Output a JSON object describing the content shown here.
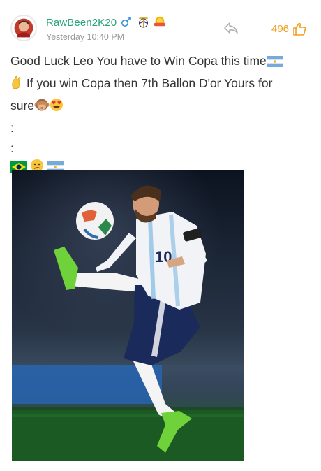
{
  "post": {
    "username": "RawBeen2K20",
    "timestamp": "Yesterday 10:40 PM",
    "likes": "496",
    "lines": [
      "Good Luck Leo You have to Win Copa this time",
      " If you win Copa then 7th Ballon D'or Yours for",
      "sure",
      ":",
      ":"
    ],
    "image_jersey_number": "10"
  },
  "icons": {
    "gender": "male-symbol-icon",
    "club_badge": "real-madrid-crest-icon",
    "rank_badge": "gold-badge-icon",
    "share": "share-arrow-icon",
    "like": "thumbs-up-icon",
    "emojis": [
      "argentina-flag-icon",
      "crossed-fingers-emoji",
      "see-no-evil-monkey-emoji",
      "heart-eyes-emoji",
      "brazil-flag-icon",
      "confused-face-emoji",
      "argentina-flag-icon"
    ]
  },
  "colors": {
    "username": "#2aa57a",
    "timestamp": "#9a9a9a",
    "likes": "#f0a020",
    "gender": "#3a8fe0",
    "text": "#333333"
  }
}
